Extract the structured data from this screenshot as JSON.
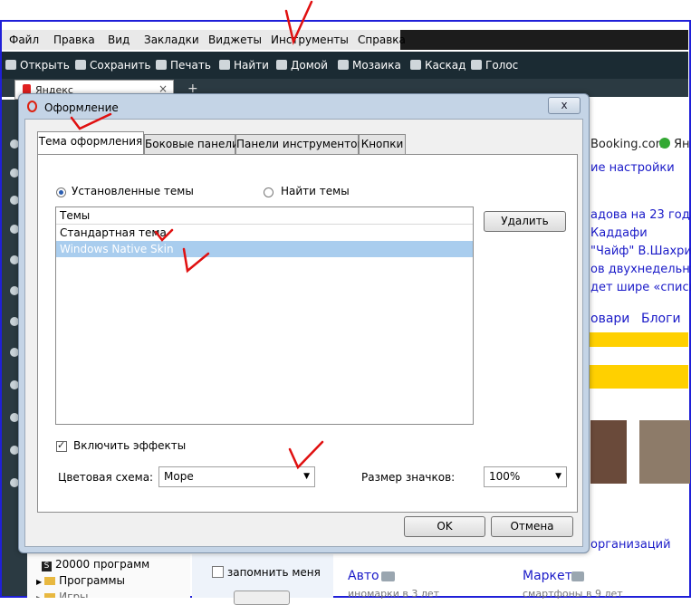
{
  "menu": {
    "items": [
      "Файл",
      "Правка",
      "Вид",
      "Закладки",
      "Виджеты",
      "Инструменты",
      "Справка"
    ]
  },
  "toolbar": {
    "items": [
      {
        "label": "Открыть",
        "icon": "open-icon"
      },
      {
        "label": "Сохранить",
        "icon": "save-icon"
      },
      {
        "label": "Печать",
        "icon": "print-icon"
      },
      {
        "label": "Найти",
        "icon": "search-icon"
      },
      {
        "label": "Домой",
        "icon": "home-icon"
      },
      {
        "label": "Мозаика",
        "icon": "tile-icon"
      },
      {
        "label": "Каскад",
        "icon": "cascade-icon"
      },
      {
        "label": "Голос",
        "icon": "microphone-icon"
      }
    ]
  },
  "browser_tab": {
    "title": "Яндекс",
    "close": "×"
  },
  "new_tab": "+",
  "background_page": {
    "links": [
      "Booking.com",
      "Ян",
      "ие настройки",
      "адова на 23 года",
      "Каддафи",
      "\"Чайф\" В.Шахрин",
      "ов двухнедельную",
      "дет шире «списка",
      "овари",
      "Блоги",
      "организаций",
      "Авто",
      "Маркет"
    ],
    "subtexts": [
      "иномарки в 3 лет",
      "смартфоны в 9 лет"
    ],
    "remember_me": "запомнить меня",
    "sidebar_items": [
      "20000 программ",
      "Программы",
      "Игры"
    ]
  },
  "dialog": {
    "title": "Оформление",
    "close_label": "x",
    "tabs": [
      "Тема оформления",
      "Боковые панели",
      "Панели инструментов",
      "Кнопки"
    ],
    "active_tab": 0,
    "radio_installed": "Установленные темы",
    "radio_find": "Найти темы",
    "list_header": "Темы",
    "themes": [
      "Стандартная тема",
      "Windows Native Skin"
    ],
    "selected_theme": 1,
    "delete_button": "Удалить",
    "effects_label": "Включить эффекты",
    "effects_checked": true,
    "color_scheme_label": "Цветовая схема:",
    "color_scheme_value": "Море",
    "icon_size_label": "Размер значков:",
    "icon_size_value": "100%",
    "ok_button": "OK",
    "cancel_button": "Отмена"
  },
  "colors": {
    "annotation_red": "#e01010",
    "selected_row": "#a9cdee",
    "toolbar_bg": "#1b2b33",
    "dialog_frame": "#c4d4e6"
  }
}
